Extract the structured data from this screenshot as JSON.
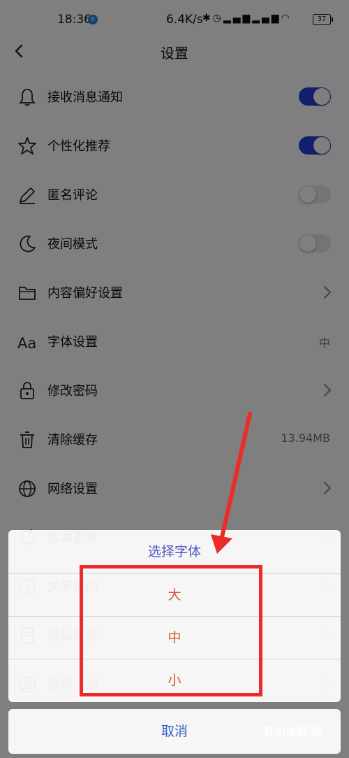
{
  "status_bar": {
    "time": "18:36",
    "badge": "e",
    "network_speed": "6.4K/s",
    "icons": [
      "bluetooth-icon",
      "alarm-icon",
      "signal-icon",
      "signal-icon",
      "wifi-icon",
      "battery-icon"
    ],
    "battery": "37"
  },
  "header": {
    "title": "设置"
  },
  "settings": [
    {
      "label": "接收消息通知",
      "icon": "bell-icon",
      "control": "toggle",
      "on": true
    },
    {
      "label": "个性化推荐",
      "icon": "star-icon",
      "control": "toggle",
      "on": true
    },
    {
      "label": "匿名评论",
      "icon": "pencil-icon",
      "control": "toggle",
      "on": false
    },
    {
      "label": "夜间模式",
      "icon": "moon-icon",
      "control": "toggle",
      "on": false
    },
    {
      "label": "内容偏好设置",
      "icon": "folder-icon",
      "control": "chevron"
    },
    {
      "label": "字体设置",
      "icon": "font-icon",
      "control": "value",
      "value": "中"
    },
    {
      "label": "修改密码",
      "icon": "lock-icon",
      "control": "chevron"
    },
    {
      "label": "清除缓存",
      "icon": "trash-icon",
      "control": "value",
      "value": "13.94MB"
    },
    {
      "label": "网络设置",
      "icon": "globe-icon",
      "control": "chevron"
    },
    {
      "label": "版本更新",
      "icon": "refresh-icon",
      "control": "chevron"
    },
    {
      "label": "关于我们",
      "icon": "info-icon",
      "control": "chevron"
    },
    {
      "label": "隐私政策",
      "icon": "document-icon",
      "control": "chevron"
    },
    {
      "label": "账号注销",
      "icon": "account-icon",
      "control": "chevron"
    }
  ],
  "font_dialog": {
    "title": "选择字体",
    "options": [
      "大",
      "中",
      "小"
    ],
    "cancel": "取消"
  },
  "watermark": "Bai度经验",
  "colors": {
    "toggle_on": "#2440d8",
    "dialog_title": "#4c55c2",
    "option_text": "#d9572a",
    "cancel_text": "#2f62c6",
    "annotation": "#ec2b2b"
  }
}
